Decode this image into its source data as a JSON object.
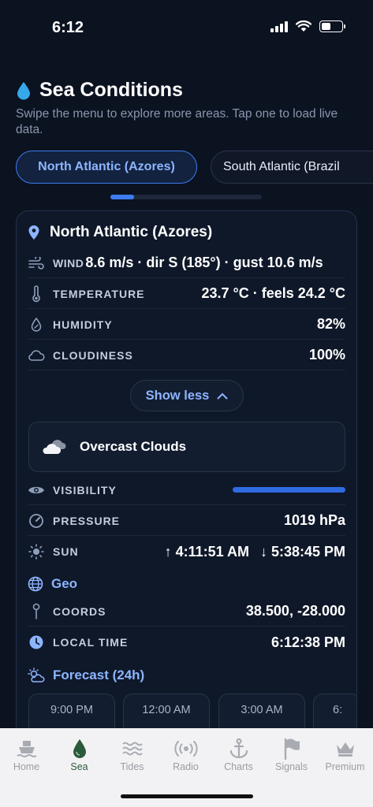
{
  "status": {
    "time": "6:12"
  },
  "header": {
    "title": "Sea Conditions",
    "subtitle": "Swipe the menu to explore more areas. Tap one to load live data."
  },
  "regions": [
    {
      "label": "North Atlantic (Azores)",
      "active": true
    },
    {
      "label": "South Atlantic (Brazil",
      "active": false
    }
  ],
  "card": {
    "location": "North Atlantic (Azores)",
    "wind": {
      "label": "WIND",
      "value": "8.6 m/s · dir S (185°) · gust 10.6 m/s"
    },
    "temperature": {
      "label": "TEMPERATURE",
      "value": "23.7 °C · feels 24.2 °C"
    },
    "humidity": {
      "label": "HUMIDITY",
      "value": "82%"
    },
    "cloudiness": {
      "label": "CLOUDINESS",
      "value": "100%"
    },
    "toggle_label": "Show less",
    "weather": "Overcast Clouds",
    "visibility": {
      "label": "VISIBILITY",
      "level": 1.0
    },
    "pressure": {
      "label": "PRESSURE",
      "value": "1019 hPa"
    },
    "sun": {
      "label": "SUN",
      "sunrise": "↑ 4:11:51 AM",
      "sunset": "↓ 5:38:45 PM"
    },
    "geo_title": "Geo",
    "coords": {
      "label": "COORDS",
      "value": "38.500, -28.000"
    },
    "local_time": {
      "label": "LOCAL TIME",
      "value": "6:12:38 PM"
    },
    "forecast_title": "Forecast (24h)",
    "forecast": [
      "9:00 PM",
      "12:00 AM",
      "3:00 AM",
      "6:"
    ]
  },
  "accent": "#3d7cf0",
  "tabs": [
    {
      "label": "Home",
      "icon": "ship-icon"
    },
    {
      "label": "Sea",
      "icon": "drop-icon",
      "active": true
    },
    {
      "label": "Tides",
      "icon": "waves-icon"
    },
    {
      "label": "Radio",
      "icon": "radio-icon"
    },
    {
      "label": "Charts",
      "icon": "anchor-icon"
    },
    {
      "label": "Signals",
      "icon": "flag-icon"
    },
    {
      "label": "Premium",
      "icon": "crown-icon"
    }
  ]
}
